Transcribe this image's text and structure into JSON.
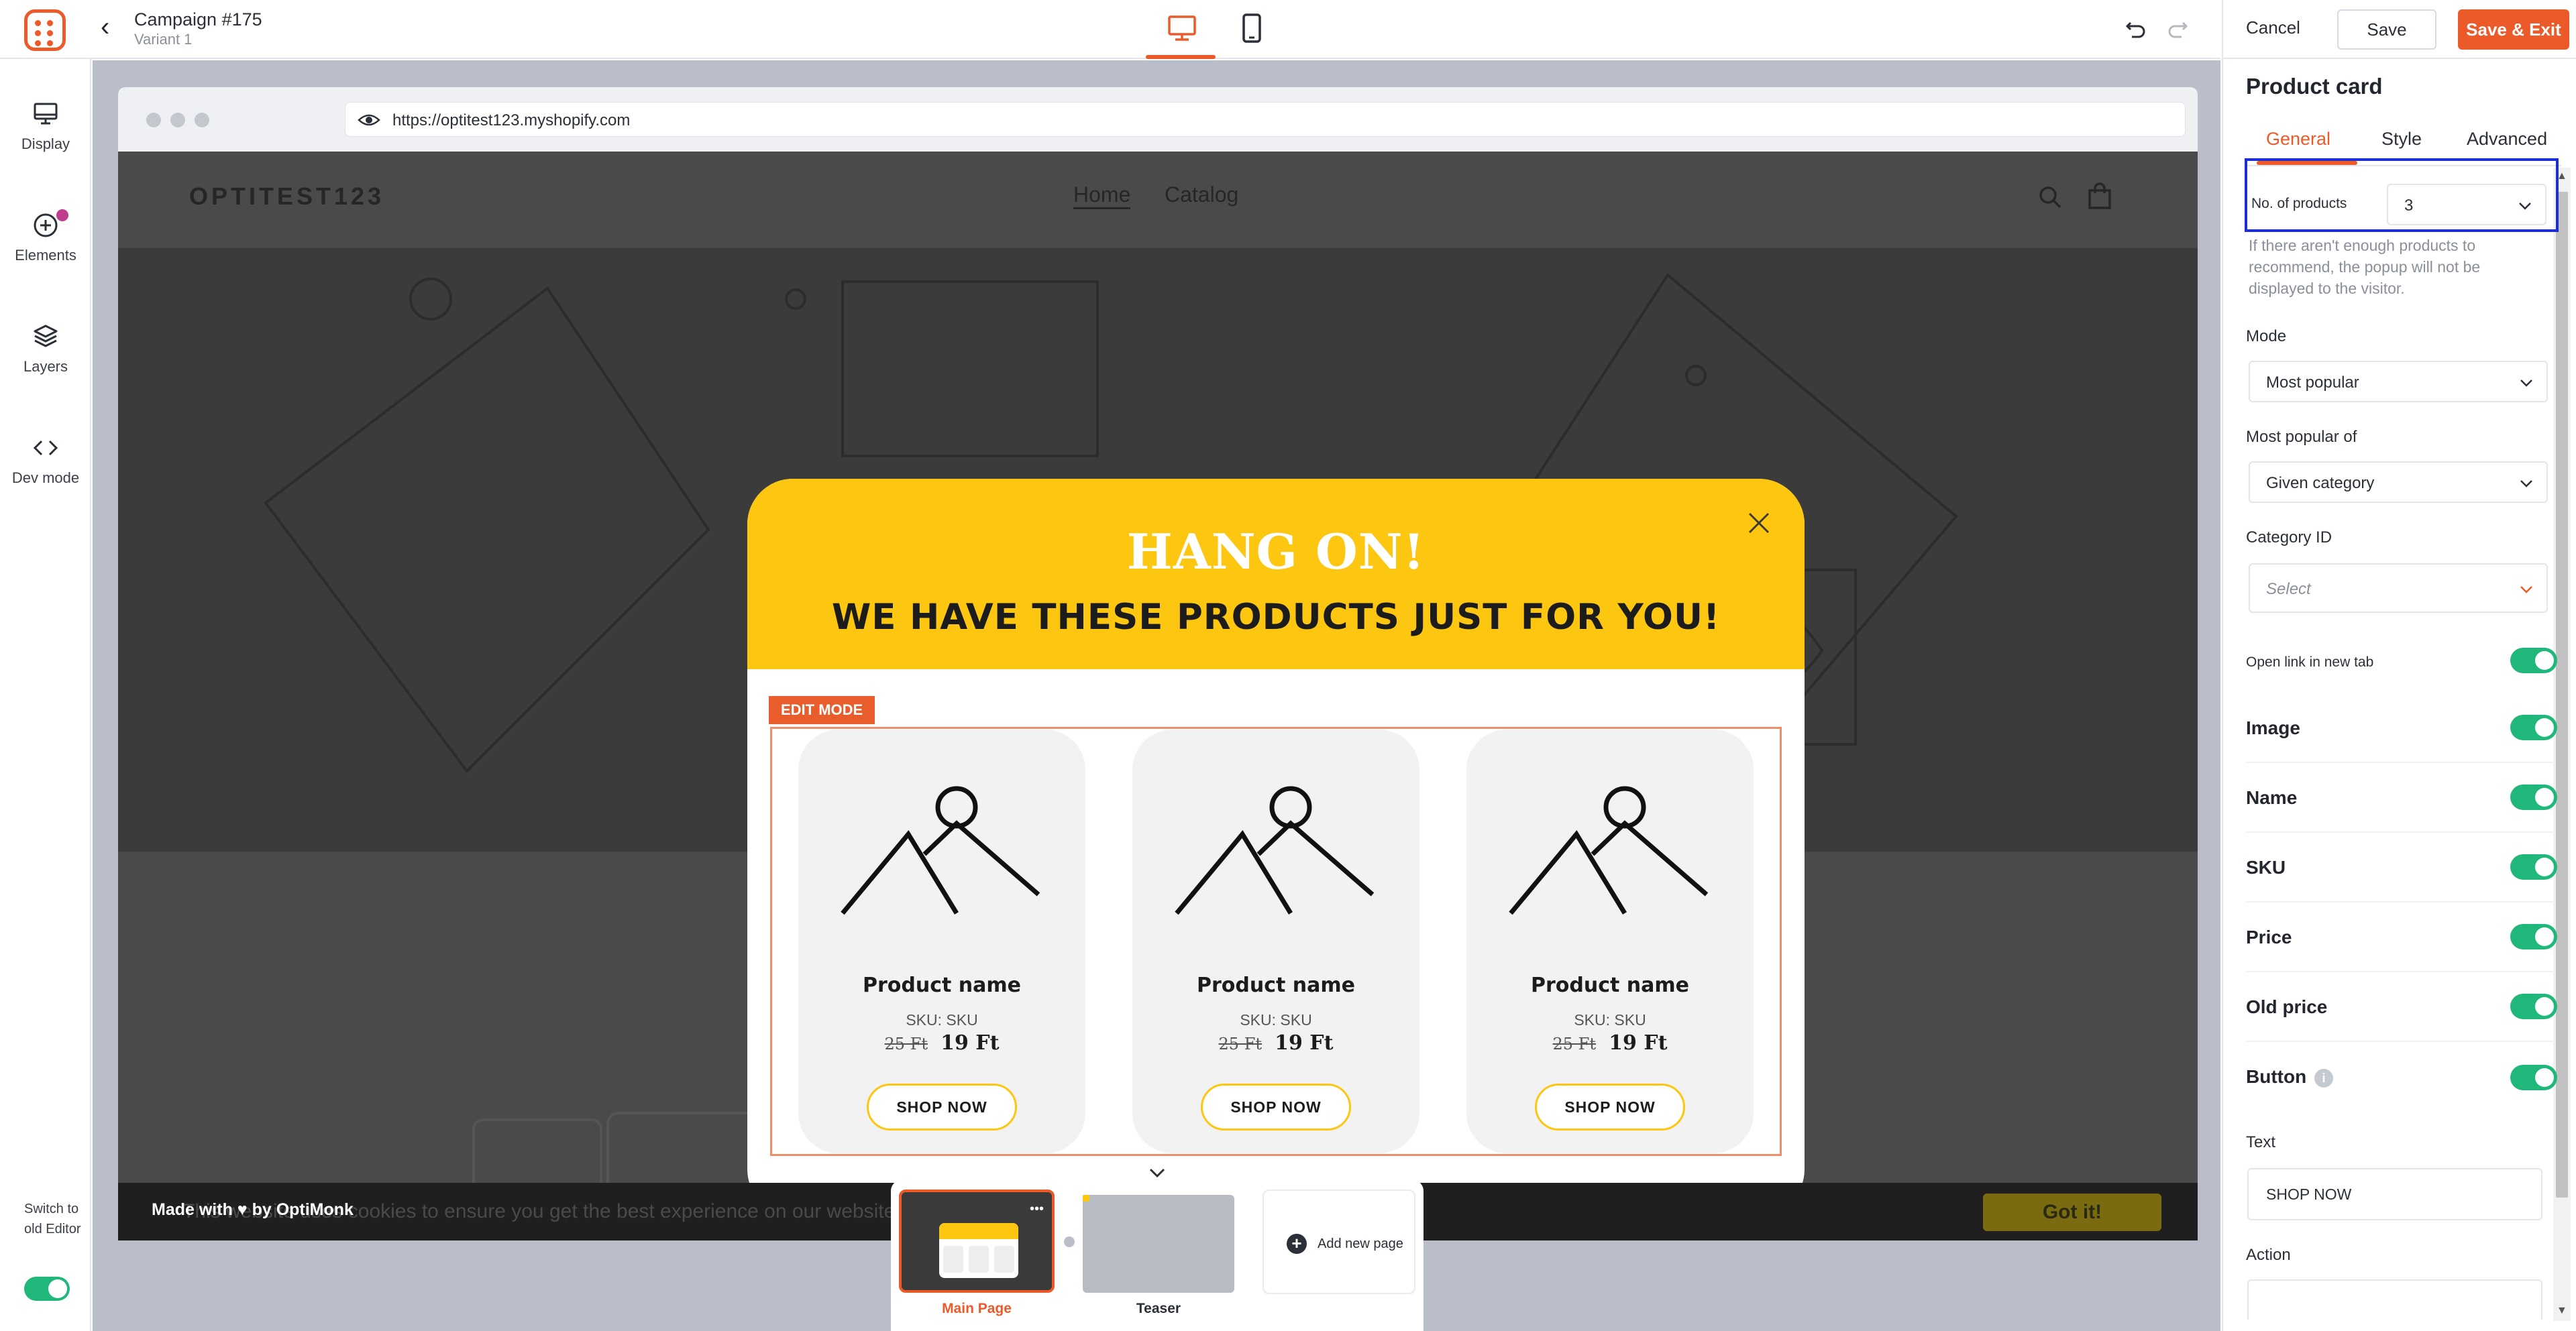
{
  "header": {
    "campaign_title": "Campaign #175",
    "variant": "Variant 1",
    "device_desktop_icon": "desktop-icon",
    "device_mobile_icon": "mobile-icon"
  },
  "sidebar": {
    "items": [
      {
        "label": "Display",
        "icon": "display-icon"
      },
      {
        "label": "Elements",
        "icon": "plus-circle-icon"
      },
      {
        "label": "Layers",
        "icon": "layers-icon"
      },
      {
        "label": "Dev mode",
        "icon": "code-icon"
      }
    ],
    "switch_old_editor": "Switch to old Editor"
  },
  "browser": {
    "url": "https://optitest123.myshopify.com"
  },
  "site": {
    "logo": "OPTITEST123",
    "nav": [
      "Home",
      "Catalog"
    ],
    "cookie_text": "This website uses cookies to ensure you get the best experience on our website.",
    "cookie_button": "Got it!",
    "made_with": "Made with ♥ by OptiMonk"
  },
  "popup": {
    "title": "HANG ON!",
    "subtitle": "WE HAVE THESE PRODUCTS JUST FOR YOU!",
    "edit_badge": "EDIT MODE",
    "accent_color": "#fcc611",
    "products": [
      {
        "name": "Product name",
        "sku": "SKU: SKU",
        "old_price": "25 Ft",
        "price": "19 Ft",
        "button": "SHOP NOW"
      },
      {
        "name": "Product name",
        "sku": "SKU: SKU",
        "old_price": "25 Ft",
        "price": "19 Ft",
        "button": "SHOP NOW"
      },
      {
        "name": "Product name",
        "sku": "SKU: SKU",
        "old_price": "25 Ft",
        "price": "19 Ft",
        "button": "SHOP NOW"
      }
    ]
  },
  "pages": {
    "main_label": "Main Page",
    "teaser_label": "Teaser",
    "add_label": "Add new page"
  },
  "panel": {
    "cancel": "Cancel",
    "save": "Save",
    "save_exit": "Save & Exit",
    "title": "Product card",
    "tabs": [
      "General",
      "Style",
      "Advanced"
    ],
    "no_products_label": "No. of products",
    "no_products_value": "3",
    "help_text": "If there aren't enough products to recommend, the popup will not be displayed to the visitor.",
    "mode_label": "Mode",
    "mode_value": "Most popular",
    "popular_of_label": "Most popular of",
    "popular_of_value": "Given category",
    "category_label": "Category ID",
    "category_placeholder": "Select",
    "open_new_tab_label": "Open link in new tab",
    "toggles": [
      {
        "label": "Image",
        "on": true
      },
      {
        "label": "Name",
        "on": true
      },
      {
        "label": "SKU",
        "on": true
      },
      {
        "label": "Price",
        "on": true
      },
      {
        "label": "Old price",
        "on": true
      },
      {
        "label": "Button",
        "on": true
      }
    ],
    "text_label": "Text",
    "text_value": "SHOP NOW",
    "action_label": "Action",
    "accent_color": "#ed5a29",
    "toggle_color": "#20b87a"
  }
}
